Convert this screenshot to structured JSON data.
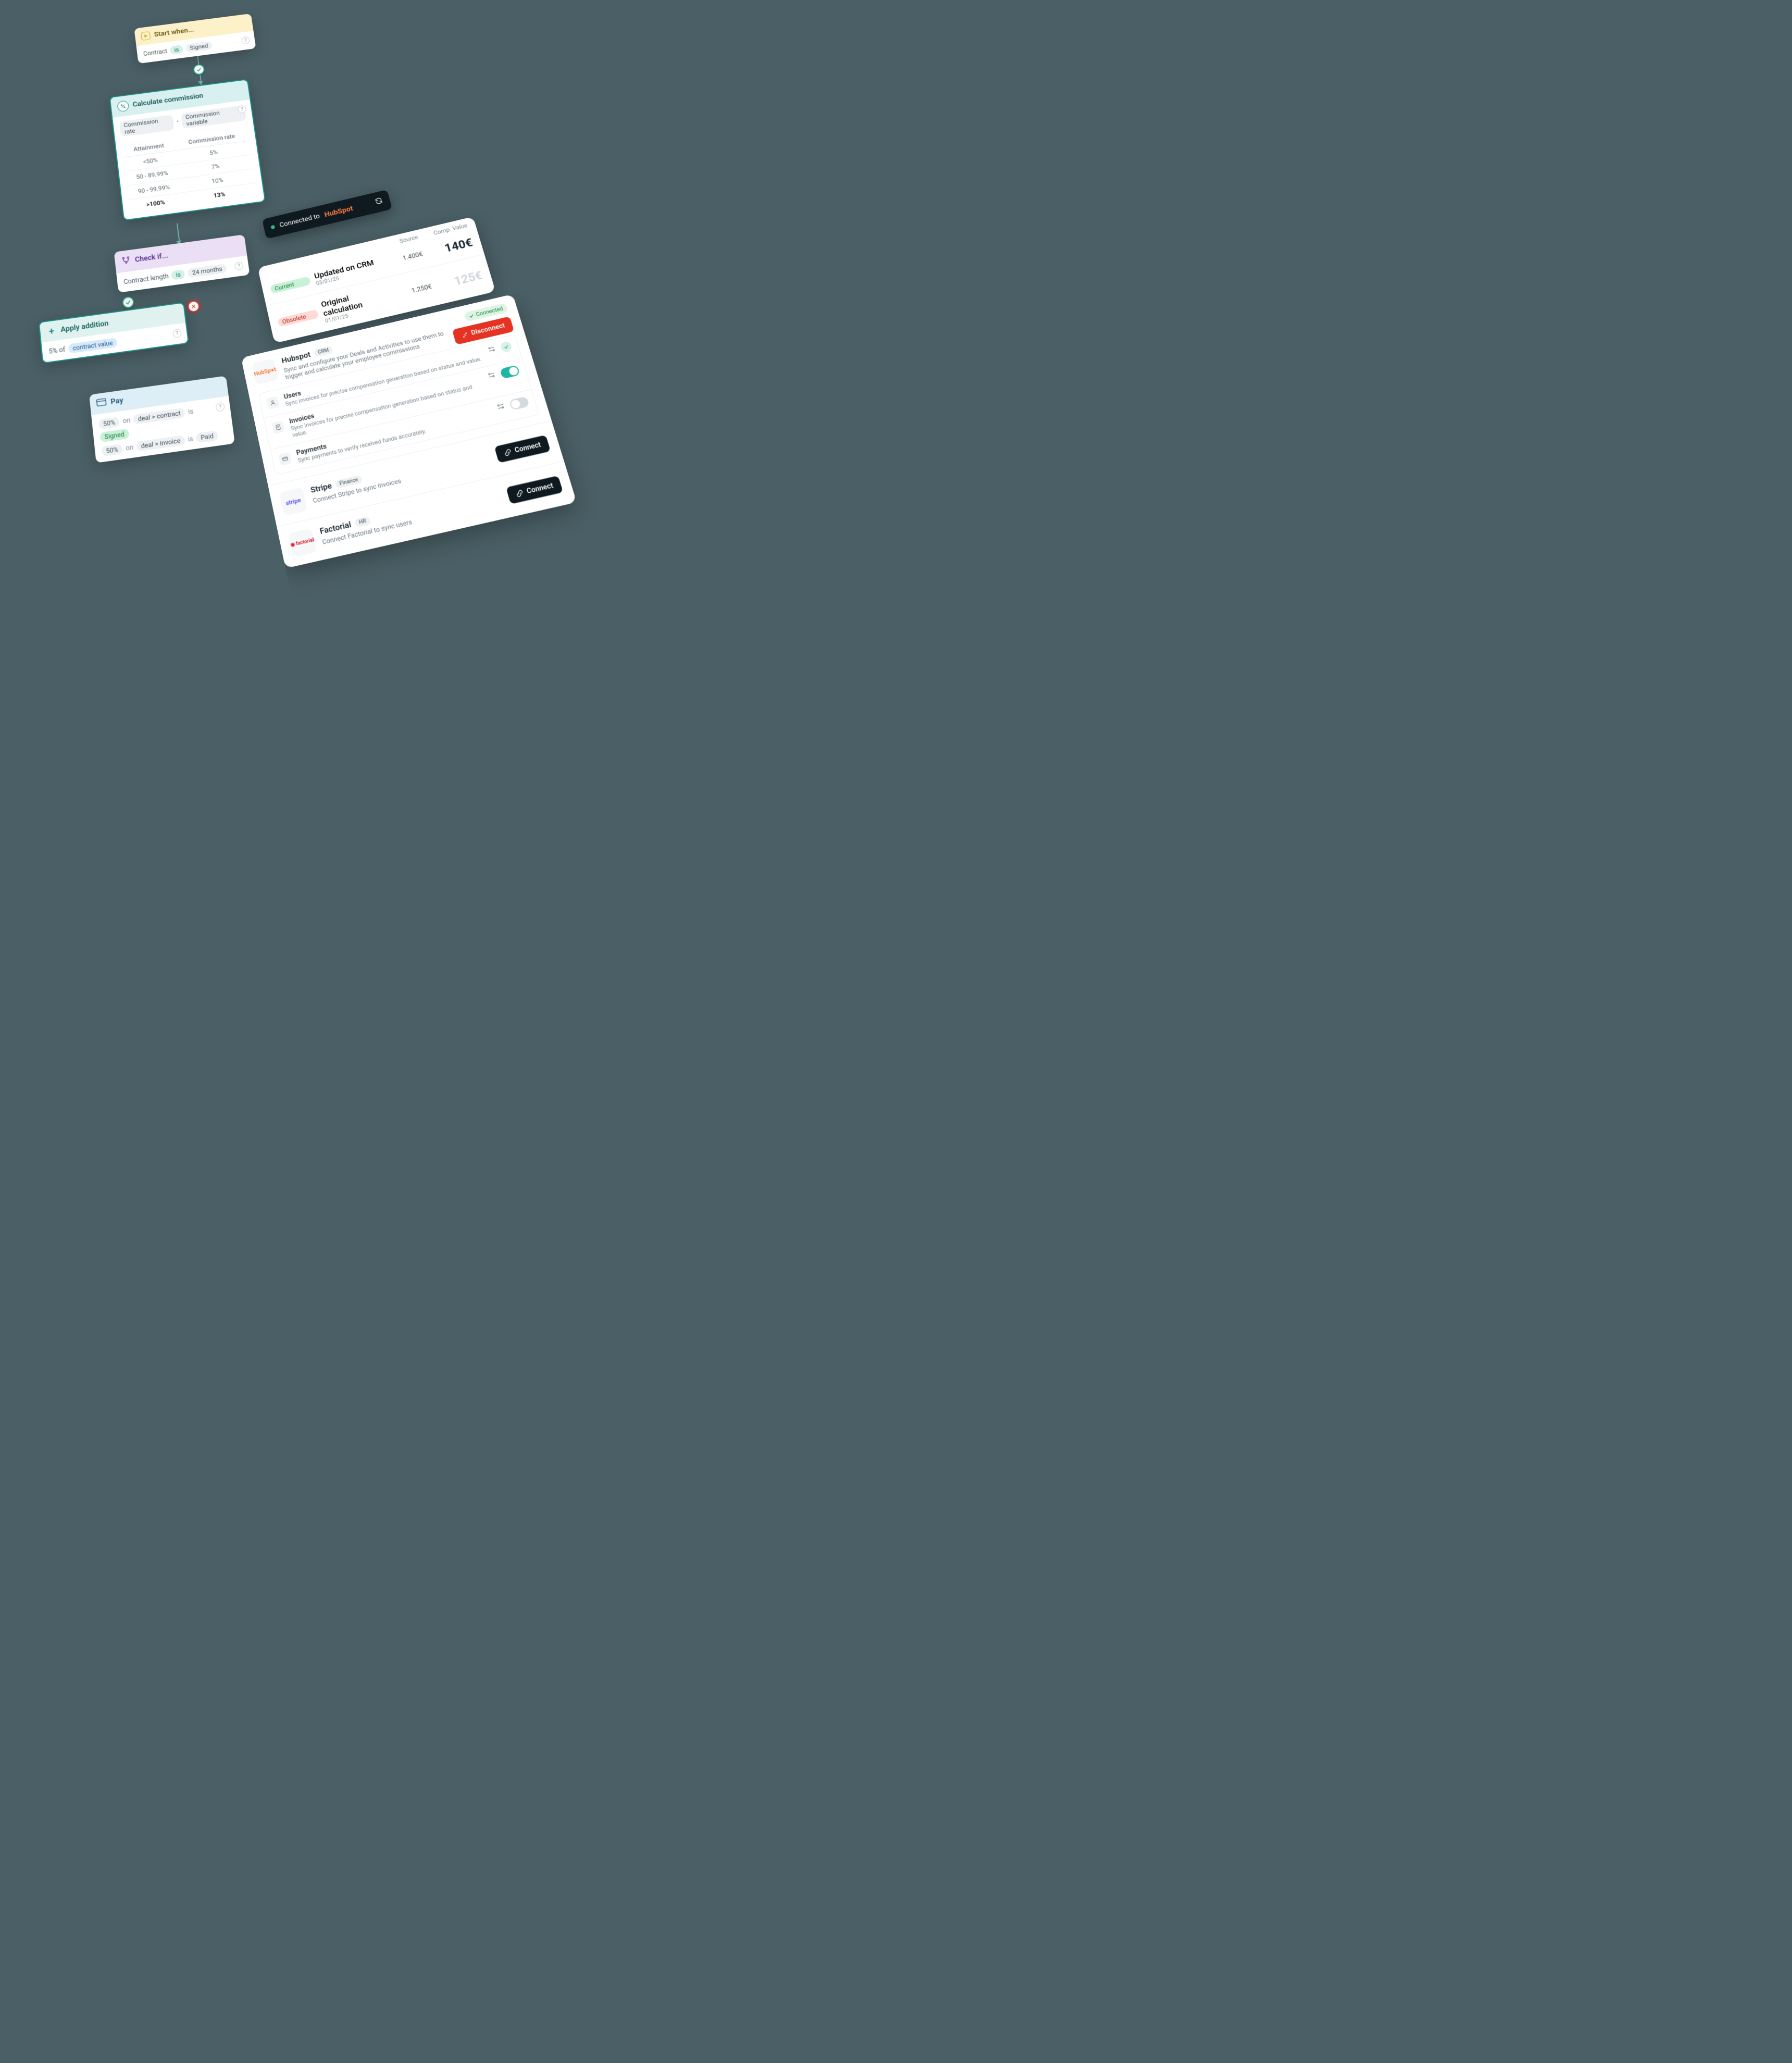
{
  "flow": {
    "start": {
      "title": "Start when...",
      "field": "Contract",
      "op": "is",
      "value": "Signed"
    },
    "calc": {
      "title": "Calculate commission",
      "left": "Commission rate",
      "right": "Commission variable",
      "table": {
        "colA": "Attainment",
        "colB": "Commission rate",
        "rows": [
          {
            "a": "<50%",
            "b": "5%"
          },
          {
            "a": "50 - 89.99%",
            "b": "7%"
          },
          {
            "a": "90 - 99.99%",
            "b": "10%"
          },
          {
            "a": ">100%",
            "b": "13%"
          }
        ]
      }
    },
    "checkif": {
      "title": "Check if...",
      "field": "Contract length",
      "op": "is",
      "value": "24 months"
    },
    "apply": {
      "title": "Apply addition",
      "prefix": "5% of",
      "target": "contract value"
    },
    "pay": {
      "title": "Pay",
      "lines": [
        {
          "pct": "50%",
          "on": "on",
          "path": "deal > contract",
          "op": "is",
          "state": "Signed",
          "state_cls": "green"
        },
        {
          "pct": "50%",
          "on": "on",
          "path": "deal > invoice",
          "op": "is",
          "state": "Paid",
          "state_cls": ""
        }
      ]
    }
  },
  "banner": {
    "label": "Connected to",
    "brand": "HubSpot"
  },
  "comp": {
    "headers": {
      "status": "",
      "desc": "",
      "source": "Source",
      "value": "Comp. Value"
    },
    "rows": [
      {
        "status": "Current",
        "status_cls": "green",
        "title": "Updated on CRM",
        "date": "03/01/25",
        "source": "1.400€",
        "value": "140€",
        "obs": false
      },
      {
        "status": "Obsolete",
        "status_cls": "red",
        "title": "Original calculation",
        "date": "01/01/25",
        "source": "1.250€",
        "value": "125€",
        "obs": true
      }
    ]
  },
  "integrations": {
    "hubspot": {
      "name": "Hubspot",
      "tag": "CRM",
      "desc": "Sync and configure your Deals and Activities to use them to trigger and calculate your employee commissions",
      "connected_label": "Connected",
      "disconnect_label": "Disconnect",
      "syncs": [
        {
          "icon": "user",
          "title": "Users",
          "desc": "Sync invoices for precise compensation generation based on status and value.",
          "ctrl": "check"
        },
        {
          "icon": "doc",
          "title": "Invoices",
          "desc": "Sync invoices for precise compensation generation based on status and value.",
          "ctrl": "toggle-on"
        },
        {
          "icon": "card",
          "title": "Payments",
          "desc": "Sync payments to verify received funds accurately.",
          "ctrl": "toggle-off"
        }
      ]
    },
    "stripe": {
      "name": "Stripe",
      "tag": "Finance",
      "desc": "Connect Stripe to sync invoices",
      "connect_label": "Connect"
    },
    "factorial": {
      "name": "Factorial",
      "tag": "HR",
      "desc": "Connect Factorial to sync users",
      "connect_label": "Connect"
    }
  }
}
